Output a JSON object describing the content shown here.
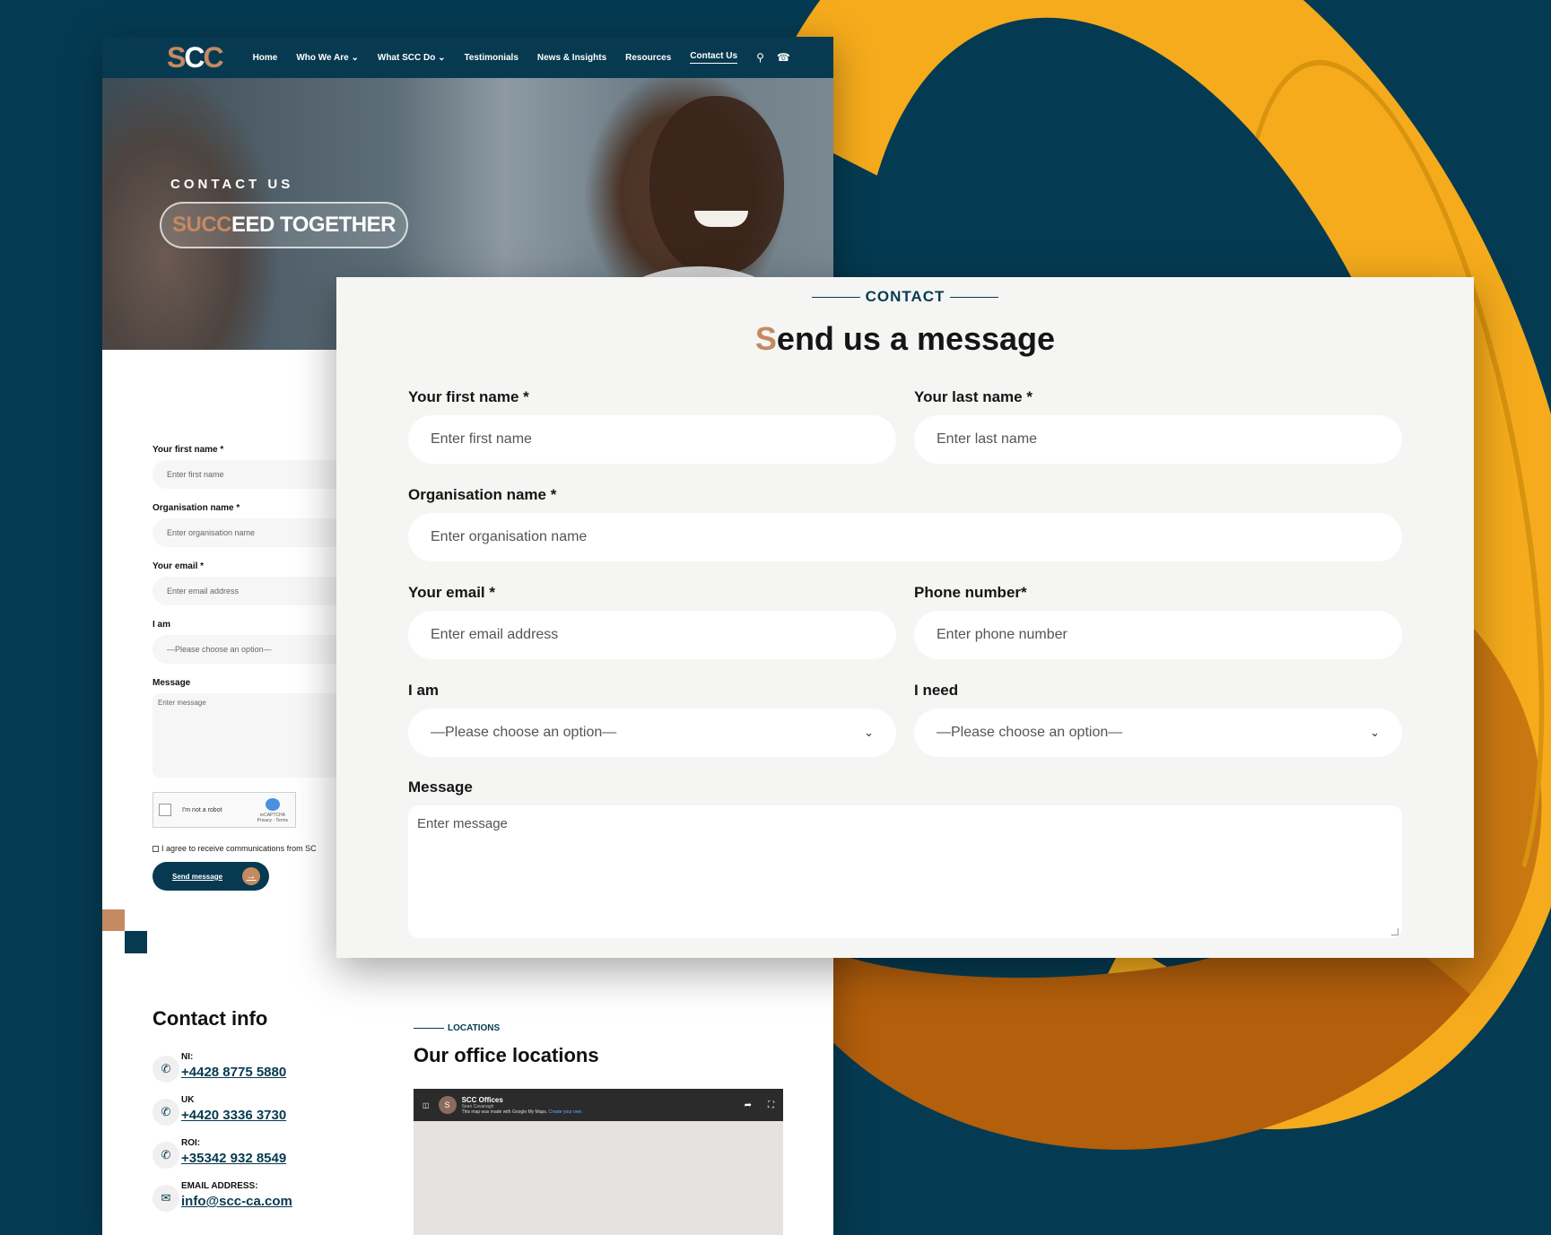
{
  "colors": {
    "background": "#053b52",
    "brand_navy": "#073a50",
    "accent_copper": "#c48a62",
    "ring_yellow": "#f5ab1c",
    "ring_orange": "#b35f0c"
  },
  "nav": {
    "logo_left": "S",
    "logo_mid": "C",
    "logo_right": "C",
    "items": [
      {
        "label": "Home"
      },
      {
        "label": "Who We Are"
      },
      {
        "label": "What SCC Do"
      },
      {
        "label": "Testimonials"
      },
      {
        "label": "News & Insights"
      },
      {
        "label": "Resources"
      },
      {
        "label": "Contact Us"
      }
    ],
    "icons": [
      "search-icon",
      "phone-icon"
    ]
  },
  "hero": {
    "kicker": "CONTACT US",
    "title_accent": "SUCC",
    "title_rest": "EED TOGETHER"
  },
  "back_form": {
    "first_name_label": "Your first name *",
    "first_name_placeholder": "Enter first name",
    "org_label": "Organisation name *",
    "org_placeholder": "Enter organisation name",
    "email_label": "Your email *",
    "email_placeholder": "Enter email address",
    "iam_label": "I am",
    "iam_placeholder": "—Please choose an option—",
    "message_label": "Message",
    "message_placeholder": "Enter message",
    "captcha_label": "I'm not a robot",
    "captcha_brand": "reCAPTCHA",
    "captcha_links": "Privacy - Terms",
    "agree_text": "I agree to receive communications from SC",
    "send_label": "Send message",
    "send_icon": "arrow-right-icon"
  },
  "contact_info": {
    "title": "Contact info",
    "rows": [
      {
        "label": "NI:",
        "value": "+4428 8775 5880",
        "icon": "phone-icon"
      },
      {
        "label": "UK",
        "value": "+4420 3336 3730",
        "icon": "phone-icon"
      },
      {
        "label": "ROI:",
        "value": "+35342 932 8549",
        "icon": "phone-icon"
      },
      {
        "label": "EMAIL ADDRESS:",
        "value": "info@scc-ca.com",
        "icon": "mail-icon"
      }
    ]
  },
  "locations": {
    "kicker": "LOCATIONS",
    "title": "Our office locations",
    "map_title": "SCC Offices",
    "map_owner": "Sean Cavanagh",
    "map_note": "This map was made with Google My Maps.",
    "map_link": "Create your own.",
    "map_avatar": "S"
  },
  "card": {
    "kicker": "CONTACT",
    "title_accent": "S",
    "title_rest": "end us a message",
    "first_name_label": "Your first name *",
    "first_name_placeholder": "Enter first name",
    "last_name_label": "Your last name *",
    "last_name_placeholder": "Enter last name",
    "org_label": "Organisation name *",
    "org_placeholder": "Enter organisation name",
    "email_label": "Your email *",
    "email_placeholder": "Enter email address",
    "phone_label": "Phone number*",
    "phone_placeholder": "Enter phone number",
    "iam_label": "I am",
    "iam_value": "—Please choose an option—",
    "ineed_label": "I need",
    "ineed_value": "—Please choose an option—",
    "message_label": "Message",
    "message_placeholder": "Enter message"
  }
}
